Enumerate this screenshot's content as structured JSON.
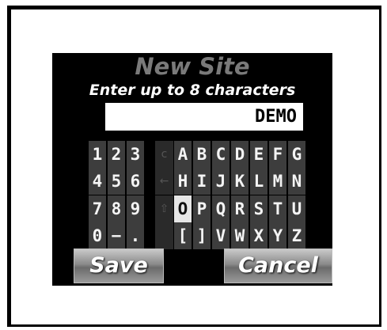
{
  "dialog": {
    "title": "New Site",
    "subtitle": "Enter up to 8 characters",
    "entry_value": "DEMO"
  },
  "keypad": {
    "numeric_rows": [
      [
        "1",
        "2",
        "3"
      ],
      [
        "4",
        "5",
        "6"
      ],
      [
        "7",
        "8",
        "9"
      ],
      [
        "0",
        "−",
        "."
      ]
    ],
    "control_keys": [
      "c",
      "←",
      "⇧",
      ""
    ],
    "control_icons": [
      "clear-icon",
      "backspace-icon",
      "shift-icon",
      "blank"
    ],
    "alpha_rows": [
      [
        "A",
        "B",
        "C",
        "D",
        "E",
        "F",
        "G"
      ],
      [
        "H",
        "I",
        "J",
        "K",
        "L",
        "M",
        "N"
      ],
      [
        "O",
        "P",
        "Q",
        "R",
        "S",
        "T",
        "U"
      ],
      [
        "[",
        "]",
        "V",
        "W",
        "X",
        "Y",
        "Z"
      ]
    ],
    "selected_key": "O"
  },
  "buttons": {
    "save_label": "Save",
    "cancel_label": "Cancel"
  },
  "colors": {
    "screen_bg": "#000000",
    "title": "#7a7a7a",
    "key_bg": "#3d3d3d",
    "key_selected_bg": "#e6e6e6"
  }
}
